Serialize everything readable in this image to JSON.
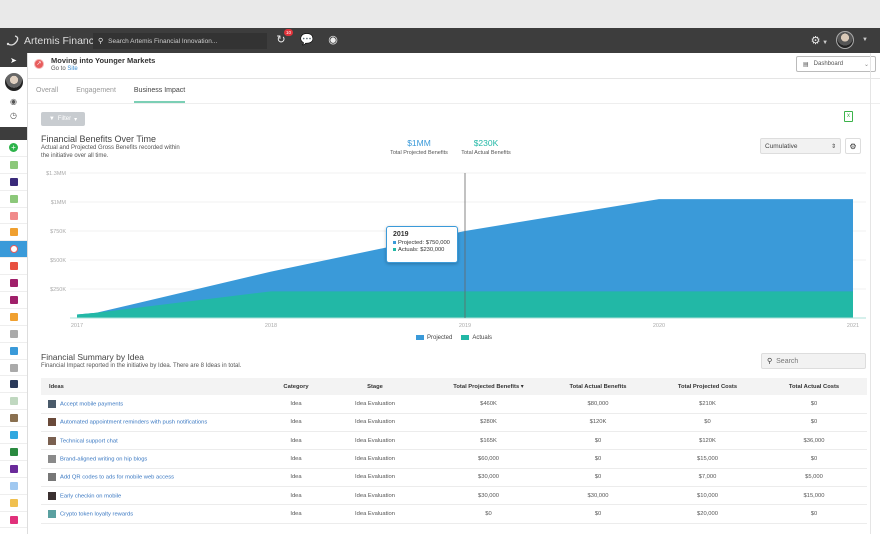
{
  "app": {
    "name": "Artemis Financial",
    "search_placeholder": "Search Artemis Financial Innovation...",
    "notification_count": "10"
  },
  "header": {
    "title": "Moving into Younger Markets",
    "goto_prefix": "Go to",
    "goto_link": "Site",
    "view_selector": "Dashboard"
  },
  "tabs": [
    {
      "label": "Overall",
      "active": false
    },
    {
      "label": "Engagement",
      "active": false
    },
    {
      "label": "Business Impact",
      "active": true
    }
  ],
  "filter_label": "Filter",
  "chart_section": {
    "title": "Financial Benefits Over Time",
    "description": "Actual and Projected Gross Benefits recorded within the initiative over all time.",
    "kpis": [
      {
        "value": "$1MM",
        "label": "Total Projected Benefits",
        "color": "#3a9ad9"
      },
      {
        "value": "$230K",
        "label": "Total Actual Benefits",
        "color": "#22b8a6"
      }
    ],
    "mode_select": "Cumulative"
  },
  "chart_data": {
    "type": "area",
    "title": "Financial Benefits Over Time",
    "xlabel": "",
    "ylabel": "",
    "x": [
      2017,
      2017.1,
      2018,
      2019,
      2020,
      2021
    ],
    "x_ticks": [
      "2017",
      "2018",
      "2019",
      "2020",
      "2021"
    ],
    "y_ticks": [
      "$250K",
      "$500K",
      "$750K",
      "$1MM",
      "$1.3MM"
    ],
    "y_tick_values": [
      250000,
      500000,
      750000,
      1000000,
      1250000
    ],
    "ylim": [
      0,
      1250000
    ],
    "grid": true,
    "legend": "bottom-center",
    "series": [
      {
        "name": "Projected",
        "color": "#3a9ad9",
        "values": [
          30000,
          45000,
          400000,
          750000,
          1025000,
          1025000
        ]
      },
      {
        "name": "Actuals",
        "color": "#22b8a6",
        "values": [
          30000,
          45000,
          230000,
          230000,
          230000,
          230000
        ]
      }
    ],
    "tooltip": {
      "title": "2019",
      "rows": [
        "Projected: $750,000",
        "Actuals: $230,000"
      ]
    },
    "crosshair_x": 2019
  },
  "summary": {
    "title": "Financial Summary by Idea",
    "description": "Financial Impact reported in the initiative by Idea. There are 8 Ideas in total.",
    "search_placeholder": "Search",
    "columns": [
      "Ideas",
      "Category",
      "Stage",
      "Total Projected Benefits ▾",
      "Total Actual Benefits",
      "Total Projected Costs",
      "Total Actual Costs"
    ],
    "rows": [
      {
        "idea": "Accept mobile payments",
        "category": "Idea",
        "stage": "Idea Evaluation",
        "proj_benefits": "$460K",
        "act_benefits": "$80,000",
        "proj_costs": "$210K",
        "act_costs": "$0",
        "thumb": "#4a5a6a"
      },
      {
        "idea": "Automated appointment reminders with push notifications",
        "category": "Idea",
        "stage": "Idea Evaluation",
        "proj_benefits": "$280K",
        "act_benefits": "$120K",
        "proj_costs": "$0",
        "act_costs": "$0",
        "thumb": "#6a4a3a"
      },
      {
        "idea": "Technical support chat",
        "category": "Idea",
        "stage": "Idea Evaluation",
        "proj_benefits": "$165K",
        "act_benefits": "$0",
        "proj_costs": "$120K",
        "act_costs": "$36,000",
        "thumb": "#7a6050"
      },
      {
        "idea": "Brand-aligned writing on hip blogs",
        "category": "Idea",
        "stage": "Idea Evaluation",
        "proj_benefits": "$60,000",
        "act_benefits": "$0",
        "proj_costs": "$15,000",
        "act_costs": "$0",
        "thumb": "#8a8a8a"
      },
      {
        "idea": "Add QR codes to ads for mobile web access",
        "category": "Idea",
        "stage": "Idea Evaluation",
        "proj_benefits": "$30,000",
        "act_benefits": "$0",
        "proj_costs": "$7,000",
        "act_costs": "$5,000",
        "thumb": "#777777"
      },
      {
        "idea": "Early checkin on mobile",
        "category": "Idea",
        "stage": "Idea Evaluation",
        "proj_benefits": "$30,000",
        "act_benefits": "$30,000",
        "proj_costs": "$10,000",
        "act_costs": "$15,000",
        "thumb": "#3a3030"
      },
      {
        "idea": "Crypto token loyalty rewards",
        "category": "Idea",
        "stage": "Idea Evaluation",
        "proj_benefits": "$0",
        "act_benefits": "$0",
        "proj_costs": "$20,000",
        "act_costs": "$0",
        "thumb": "#5aa0a0"
      }
    ]
  },
  "sidebar": {
    "items": [
      {
        "name": "add",
        "color": "#2db34a"
      },
      {
        "name": "item-1",
        "color": "#8cc87a"
      },
      {
        "name": "item-2",
        "color": "#3a2a7a"
      },
      {
        "name": "item-3",
        "color": "#8cc87a"
      },
      {
        "name": "item-4",
        "color": "#f08a8a"
      },
      {
        "name": "item-5",
        "color": "#f0a030"
      },
      {
        "name": "item-6-active",
        "color": "#ffffff"
      },
      {
        "name": "item-7",
        "color": "#e85040"
      },
      {
        "name": "item-8",
        "color": "#a0206a"
      },
      {
        "name": "item-9",
        "color": "#a0206a"
      },
      {
        "name": "item-10",
        "color": "#f0a030"
      },
      {
        "name": "item-11",
        "color": "#aaaaaa"
      },
      {
        "name": "item-12",
        "color": "#3a9ad9"
      },
      {
        "name": "item-13",
        "color": "#aaaaaa"
      },
      {
        "name": "item-14",
        "color": "#2a3a5a"
      },
      {
        "name": "item-15",
        "color": "#c0d8c0"
      },
      {
        "name": "item-16",
        "color": "#8a7050"
      },
      {
        "name": "item-17",
        "color": "#30a8e0"
      },
      {
        "name": "item-18",
        "color": "#2a8a40"
      },
      {
        "name": "item-19",
        "color": "#6a2a9a"
      },
      {
        "name": "item-20",
        "color": "#a0c8f0"
      },
      {
        "name": "item-21",
        "color": "#f0c050"
      },
      {
        "name": "item-22",
        "color": "#e0307a"
      }
    ]
  }
}
